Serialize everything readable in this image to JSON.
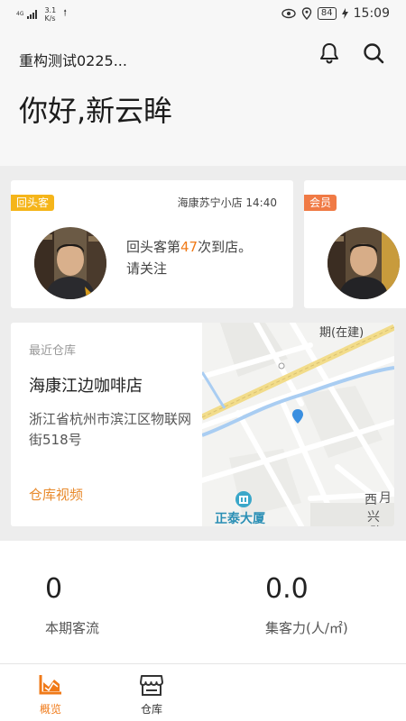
{
  "status_bar": {
    "network": "4G",
    "speed_value": "3.1",
    "speed_unit": "K/s",
    "battery": "84",
    "time": "15:09"
  },
  "header": {
    "store_name": "重构测试0225...",
    "greeting": "你好,新云眸",
    "bell_icon": "bell-icon",
    "search_icon": "search-icon"
  },
  "customer_cards": [
    {
      "tag": "回头客",
      "store_time": "海康苏宁小店 14:40",
      "visit_prefix": "回头客第",
      "visit_count": "47",
      "visit_suffix": "次到店。",
      "visit_line2": "请关注"
    },
    {
      "tag": "会员"
    }
  ],
  "warehouse": {
    "label": "最近仓库",
    "name": "海康江边咖啡店",
    "address": "浙江省杭州市滨江区物联网街518号",
    "video_link": "仓库视频",
    "map": {
      "label_top": "期(在建)",
      "label_poi": "正泰大厦",
      "label_road1": "西",
      "label_road2": "兴",
      "label_road3": "路",
      "label_right": "月"
    }
  },
  "stats": [
    {
      "value": "0",
      "label": "本期客流"
    },
    {
      "value": "0.0",
      "label": "集客力(人/㎡)"
    }
  ],
  "tabbar": [
    {
      "label": "概览",
      "active": true
    },
    {
      "label": "仓库",
      "active": false
    }
  ],
  "colors": {
    "accent_orange": "#f07a18",
    "tag_yellow": "#f5b51a",
    "tag_orange": "#f07a45",
    "link_orange": "#e88a2c"
  }
}
